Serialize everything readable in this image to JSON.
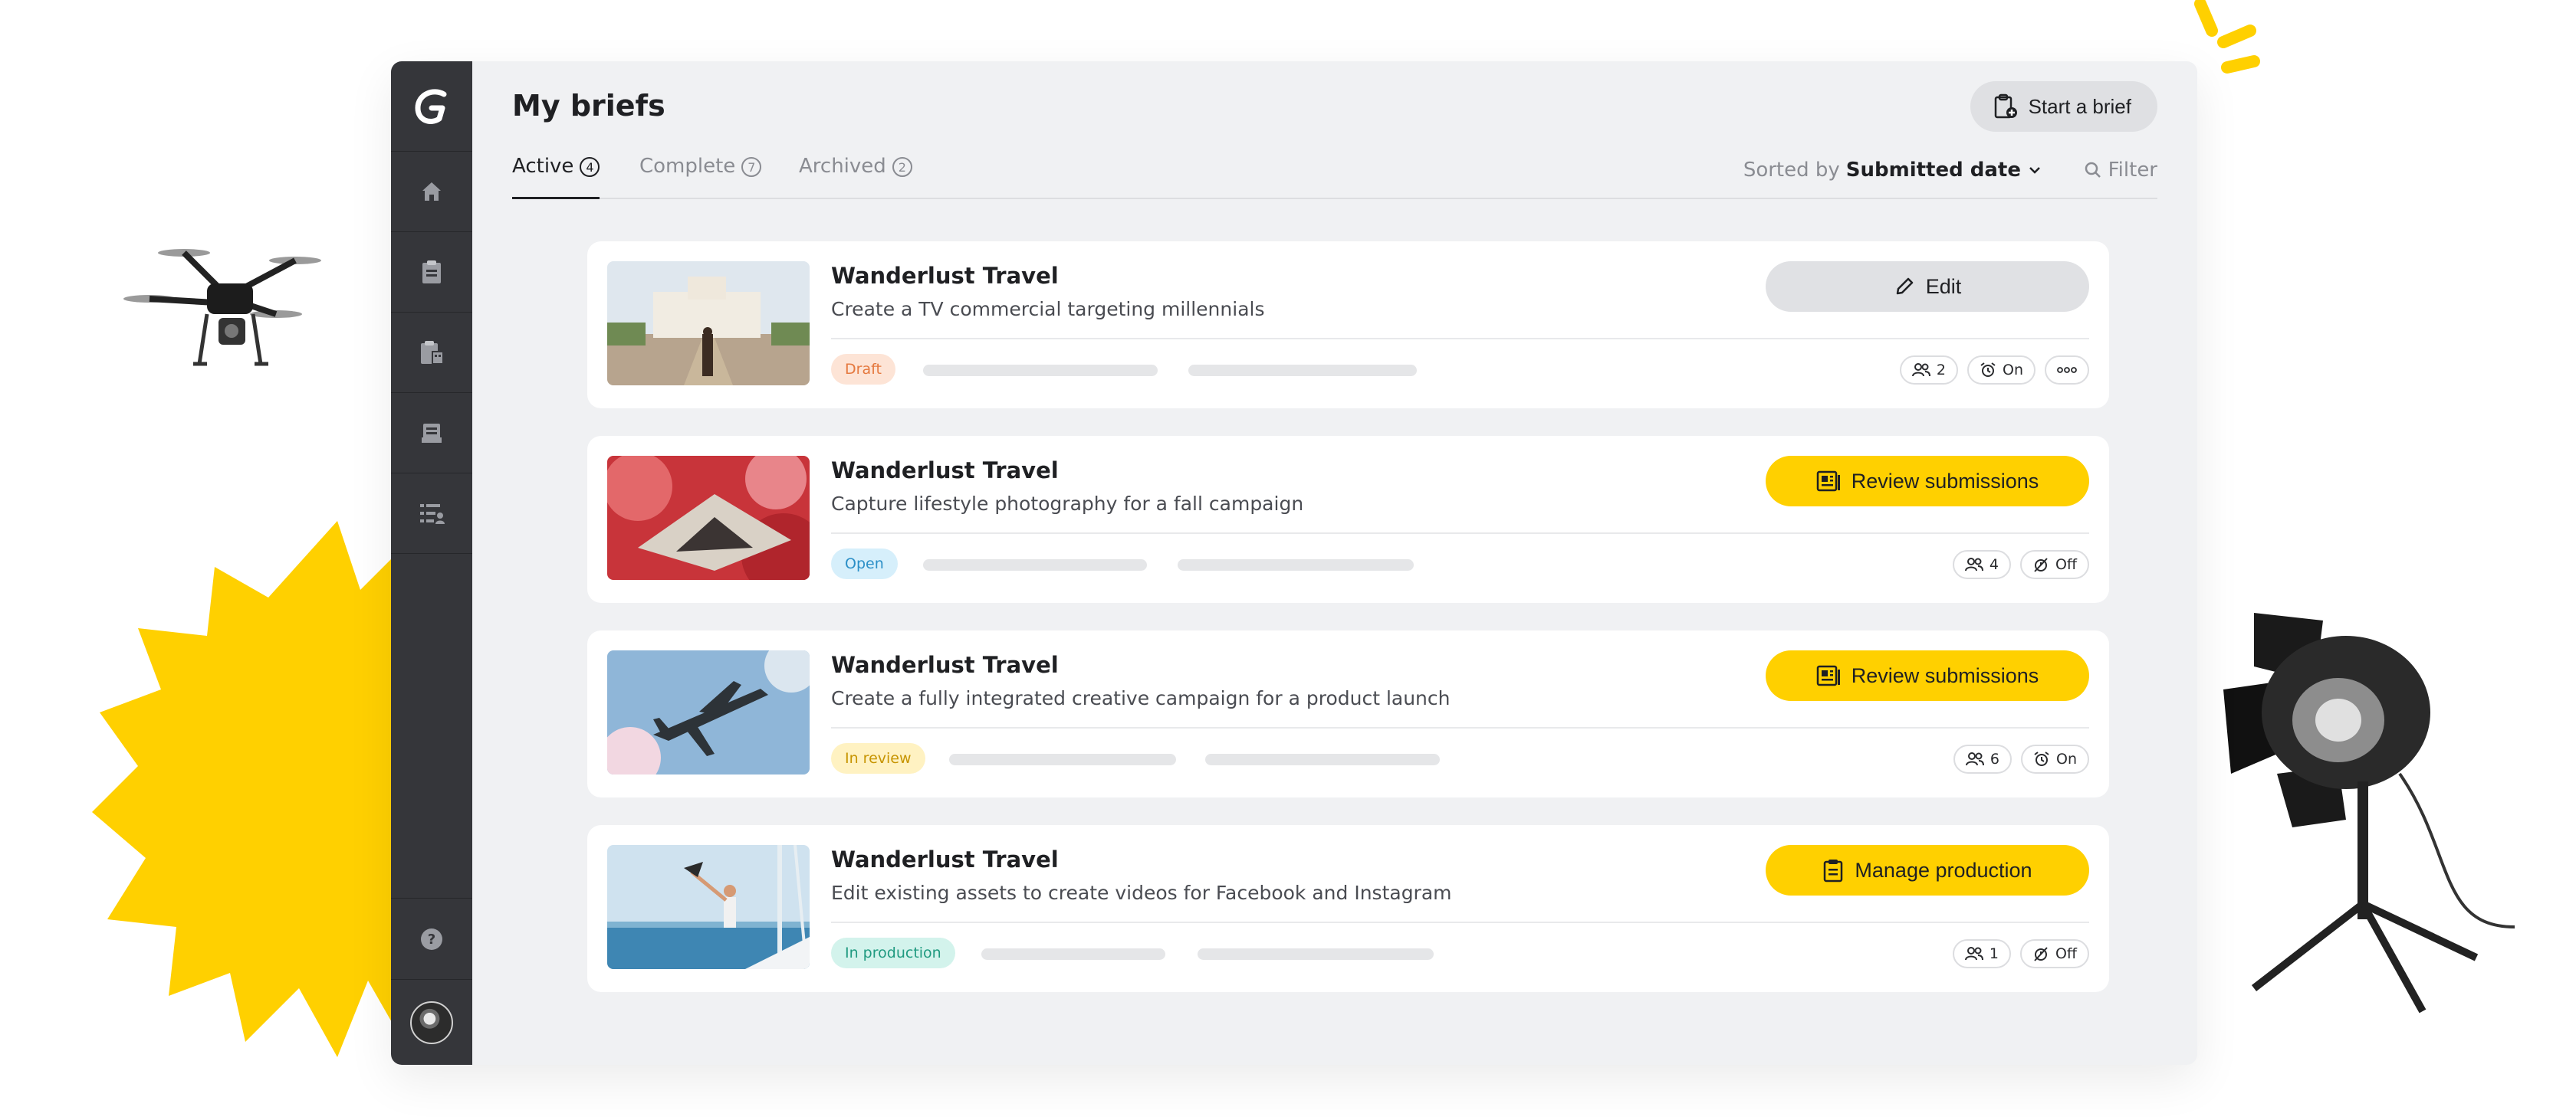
{
  "page": {
    "title": "My briefs"
  },
  "header": {
    "start_brief_label": "Start a brief"
  },
  "tabs": [
    {
      "label": "Active",
      "count": "4"
    },
    {
      "label": "Complete",
      "count": "7"
    },
    {
      "label": "Archived",
      "count": "2"
    }
  ],
  "sort": {
    "prefix": "Sorted by",
    "value": "Submitted date"
  },
  "filter": {
    "label": "Filter"
  },
  "briefs": [
    {
      "client": "Wanderlust Travel",
      "description": "Create a TV commercial targeting millennials",
      "status": "Draft",
      "action": "Edit",
      "members": "2",
      "notifications": "On"
    },
    {
      "client": "Wanderlust Travel",
      "description": "Capture lifestyle photography for a fall campaign",
      "status": "Open",
      "action": "Review submissions",
      "members": "4",
      "notifications": "Off"
    },
    {
      "client": "Wanderlust Travel",
      "description": "Create a fully integrated creative campaign for a product launch",
      "status": "In review",
      "action": "Review submissions",
      "members": "6",
      "notifications": "On"
    },
    {
      "client": "Wanderlust Travel",
      "description": "Edit existing assets to create videos for Facebook and Instagram",
      "status": "In production",
      "action": "Manage production",
      "members": "1",
      "notifications": "Off"
    }
  ],
  "colors": {
    "accent_yellow": "#ffd000",
    "sidebar": "#35363a",
    "draft_bg": "#fde4d6",
    "draft_fg": "#e5793f",
    "open_bg": "#d6effb",
    "open_fg": "#2b8fc7",
    "review_bg": "#fff2c2",
    "review_fg": "#c79400",
    "production_bg": "#d3f3ec",
    "production_fg": "#1f9a80"
  },
  "icons": {
    "logo": "brand-logo-icon",
    "nav": [
      "home-icon",
      "clipboard-icon",
      "clipboard-building-icon",
      "inbox-icon",
      "checklist-user-icon"
    ],
    "help": "help-icon",
    "card_actions": [
      "pencil-icon",
      "review-icon",
      "review-icon",
      "clipboard-icon"
    ]
  }
}
